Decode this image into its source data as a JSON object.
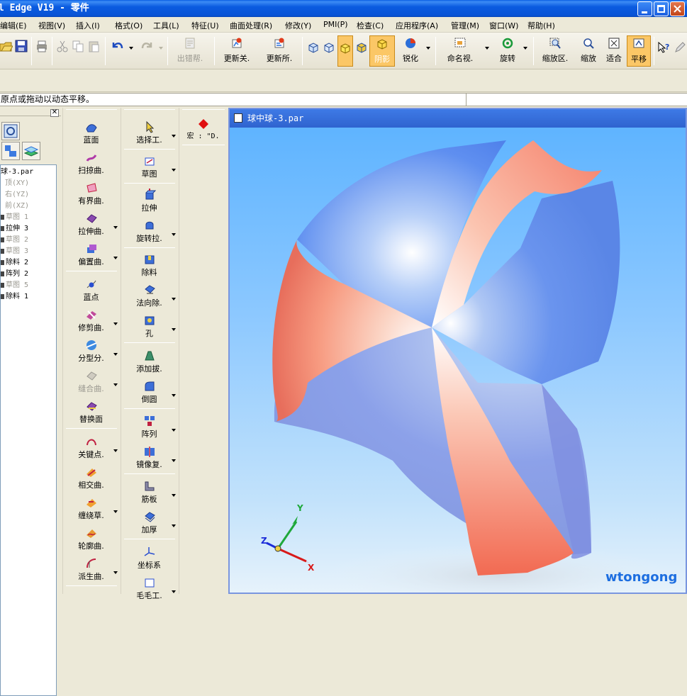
{
  "window": {
    "title": "l Edge V19 - 零件"
  },
  "menu": [
    "编辑(E)",
    "视图(V)",
    "插入(I)",
    "格式(O)",
    "工具(L)",
    "特征(U)",
    "曲面处理(R)",
    "修改(Y)",
    "PMI(P)",
    "检查(C)",
    "应用程序(A)",
    "管理(M)",
    "窗口(W)",
    "帮助(H)"
  ],
  "toolbar": {
    "error_label": "出错帮.",
    "update_rel_label": "更新关.",
    "update_all_label": "更新所.",
    "shade_label": "阴影",
    "sharpen_label": "锐化",
    "named_view_label": "命名视.",
    "rotate_label": "旋转",
    "zoom_area_label": "缩放区.",
    "zoom_label": "缩放",
    "fit_label": "适合",
    "pan_label": "平移"
  },
  "prompt": {
    "text": "原点或拖动以动态平移。"
  },
  "pathfinder": {
    "items": [
      {
        "label": "球-3.par",
        "muted": false,
        "bullet": false
      },
      {
        "label": "顶(XY)",
        "muted": true,
        "bullet": false
      },
      {
        "label": "右(YZ)",
        "muted": true,
        "bullet": false
      },
      {
        "label": "前(XZ)",
        "muted": true,
        "bullet": false
      },
      {
        "label": "草图 1",
        "muted": true,
        "bullet": true
      },
      {
        "label": "拉伸 3",
        "muted": false,
        "bullet": true
      },
      {
        "label": "草图 2",
        "muted": true,
        "bullet": true
      },
      {
        "label": "草图 3",
        "muted": true,
        "bullet": true
      },
      {
        "label": "除料 2",
        "muted": false,
        "bullet": true
      },
      {
        "label": "阵列 2",
        "muted": false,
        "bullet": true
      },
      {
        "label": "草图 5",
        "muted": true,
        "bullet": true
      },
      {
        "label": "除料 1",
        "muted": false,
        "bullet": true
      }
    ]
  },
  "surface_commands": [
    {
      "label": "蓝面",
      "dd": false,
      "disabled": false
    },
    {
      "label": "扫掠曲.",
      "dd": false,
      "disabled": false
    },
    {
      "label": "有界曲.",
      "dd": false,
      "disabled": false
    },
    {
      "label": "拉伸曲.",
      "dd": true,
      "disabled": false
    },
    {
      "label": "偏置曲.",
      "dd": true,
      "disabled": false
    },
    {
      "label": "蓝点",
      "dd": false,
      "disabled": false
    },
    {
      "label": "修剪曲.",
      "dd": true,
      "disabled": false
    },
    {
      "label": "分型分.",
      "dd": true,
      "disabled": false
    },
    {
      "label": "缝合曲.",
      "dd": true,
      "disabled": true
    },
    {
      "label": "替换面",
      "dd": false,
      "disabled": false
    },
    {
      "label": "关键点.",
      "dd": true,
      "disabled": false
    },
    {
      "label": "相交曲.",
      "dd": false,
      "disabled": false
    },
    {
      "label": "缠绕草.",
      "dd": true,
      "disabled": false
    },
    {
      "label": "轮廓曲.",
      "dd": false,
      "disabled": false
    },
    {
      "label": "派生曲.",
      "dd": true,
      "disabled": false
    }
  ],
  "feature_commands": [
    {
      "label": "选择工.",
      "dd": true
    },
    {
      "label": "草图",
      "dd": true
    },
    {
      "label": "拉伸",
      "dd": false
    },
    {
      "label": "旋转拉.",
      "dd": true
    },
    {
      "label": "除料",
      "dd": false
    },
    {
      "label": "法向除.",
      "dd": true
    },
    {
      "label": "孔",
      "dd": true
    },
    {
      "label": "添加拔.",
      "dd": false
    },
    {
      "label": "倒圆",
      "dd": true
    },
    {
      "label": "阵列",
      "dd": true
    },
    {
      "label": "镜像复.",
      "dd": true
    },
    {
      "label": "筋板",
      "dd": true
    },
    {
      "label": "加厚",
      "dd": true
    },
    {
      "label": "坐标系",
      "dd": false
    },
    {
      "label": "毛毛工.",
      "dd": true
    }
  ],
  "macro": {
    "label": "宏 : \"D."
  },
  "viewport": {
    "title": "球中球-3.par",
    "axis_x": "X",
    "axis_y": "Y",
    "axis_z": "Z",
    "watermark": "wtongong"
  },
  "colors": {
    "title_blue": "#0a5be0",
    "active_orange": "#fbc766",
    "face_blue": "#5f8ff0",
    "face_pink": "#f3826a"
  }
}
